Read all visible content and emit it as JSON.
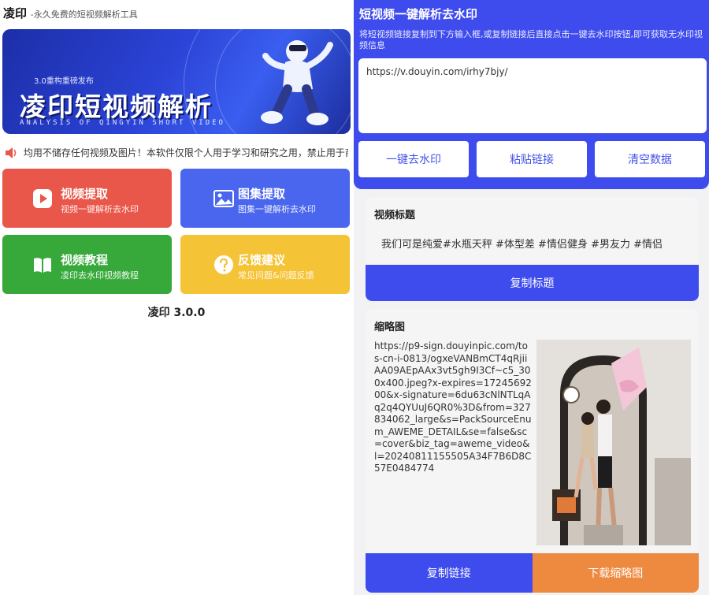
{
  "left": {
    "brand": "凌印",
    "tagline": "-永久免费的短视频解析工具",
    "banner": {
      "small_tag": "3.0重构重磅发布",
      "title": "凌印短视频解析",
      "subtitle": "ANALYSIS OF QINGYIN SHORT VIDEO"
    },
    "notice": "均用不储存任何视频及图片！本软件仅限个人用于学习和研究之用，禁止用于商",
    "tiles": [
      {
        "title": "视频提取",
        "sub": "视频一键解析去水印",
        "icon": "play-icon"
      },
      {
        "title": "图集提取",
        "sub": "图集一键解析去水印",
        "icon": "image-icon"
      },
      {
        "title": "视频教程",
        "sub": "凌印去水印视频教程",
        "icon": "book-icon"
      },
      {
        "title": "反馈建议",
        "sub": "常见问题&问题反馈",
        "icon": "question-icon"
      }
    ],
    "version": "凌印 3.0.0"
  },
  "right": {
    "title": "短视频一键解析去水印",
    "description": "将短视频链接复制到下方输入框,或复制链接后直接点击一键去水印按钮,即可获取无水印视频信息",
    "url_value": "https://v.douyin.com/irhy7bjy/",
    "buttons": {
      "remove": "一键去水印",
      "paste": "粘贴链接",
      "clear": "清空数据"
    },
    "title_card": {
      "heading": "视频标题",
      "text": "我们可是纯爱#水瓶天秤 #体型差 #情侣健身 #男友力 #情侣",
      "copy_button": "复制标题"
    },
    "thumb_card": {
      "heading": "缩略图",
      "url": "https://p9-sign.douyinpic.com/tos-cn-i-0813/ogxeVANBmCT4qRjiiAA09AEpAAx3vt5gh9I3Cf~c5_300x400.jpeg?x-expires=1724569200&x-signature=6du63cNlNTLqAq2q4QYUuJ6QR0%3D&from=327834062_large&s=PackSourceEnum_AWEME_DETAIL&se=false&sc=cover&biz_tag=aweme_video&l=20240811155505A34F7B6D8C57E0484774",
      "copy_button": "复制链接",
      "download_button": "下载缩略图"
    }
  },
  "colors": {
    "accent_blue": "#3f4ced",
    "tile_red": "#e9564a",
    "tile_blue": "#4a66ee",
    "tile_green": "#36a93a",
    "tile_yellow": "#f5c336",
    "download_orange": "#ee8a3f"
  }
}
